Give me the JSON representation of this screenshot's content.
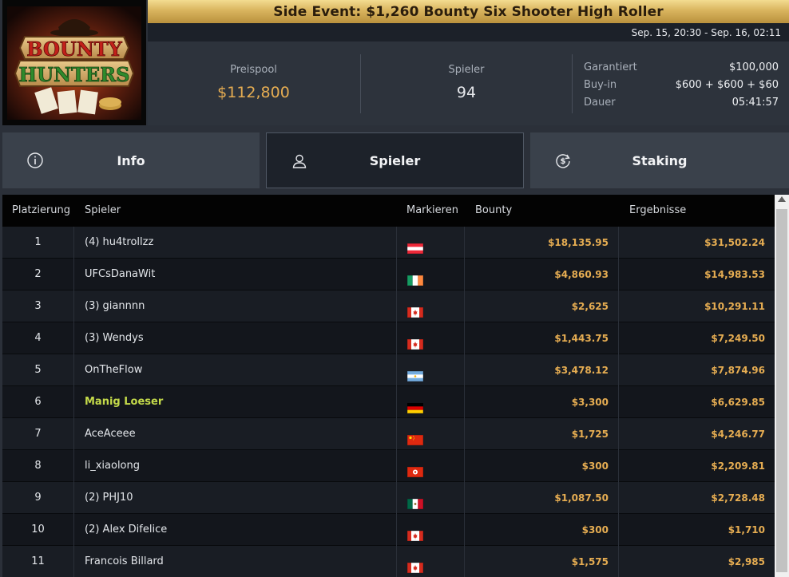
{
  "header": {
    "title": "Side Event: $1,260 Bounty Six Shooter High Roller",
    "dates": "Sep. 15, 20:30 - Sep. 16, 02:11",
    "logo_text": [
      "BOUNTY",
      "HUNTERS"
    ]
  },
  "stats": {
    "prizepool_label": "Preispool",
    "prizepool_value": "$112,800",
    "players_label": "Spieler",
    "players_value": "94",
    "details": [
      {
        "label": "Garantiert",
        "value": "$100,000"
      },
      {
        "label": "Buy-in",
        "value": "$600 + $600 + $60"
      },
      {
        "label": "Dauer",
        "value": "05:41:57"
      }
    ]
  },
  "tabs": [
    {
      "label": "Info",
      "icon": "info-icon"
    },
    {
      "label": "Spieler",
      "icon": "user-icon",
      "active": true
    },
    {
      "label": "Staking",
      "icon": "dollar-cycle-icon"
    }
  ],
  "table": {
    "columns": [
      "Platzierung",
      "Spieler",
      "Markieren",
      "Bounty",
      "Ergebnisse"
    ],
    "rows": [
      {
        "rank": "1",
        "player": "(4) hu4trollzz",
        "flag": "austria",
        "bounty": "$18,135.95",
        "result": "$31,502.24"
      },
      {
        "rank": "2",
        "player": "UFCsDanaWit",
        "flag": "ireland",
        "bounty": "$4,860.93",
        "result": "$14,983.53"
      },
      {
        "rank": "3",
        "player": "(3) giannnn",
        "flag": "canada",
        "bounty": "$2,625",
        "result": "$10,291.11"
      },
      {
        "rank": "4",
        "player": "(3) Wendys",
        "flag": "canada",
        "bounty": "$1,443.75",
        "result": "$7,249.50"
      },
      {
        "rank": "5",
        "player": "OnTheFlow",
        "flag": "argentina",
        "bounty": "$3,478.12",
        "result": "$7,874.96"
      },
      {
        "rank": "6",
        "player": "Manig Loeser",
        "flag": "germany",
        "bounty": "$3,300",
        "result": "$6,629.85",
        "highlight": true
      },
      {
        "rank": "7",
        "player": "AceAceee",
        "flag": "china",
        "bounty": "$1,725",
        "result": "$4,246.77"
      },
      {
        "rank": "8",
        "player": "li_xiaolong",
        "flag": "hongkong",
        "bounty": "$300",
        "result": "$2,209.81"
      },
      {
        "rank": "9",
        "player": "(2) PHJ10",
        "flag": "mexico",
        "bounty": "$1,087.50",
        "result": "$2,728.48"
      },
      {
        "rank": "10",
        "player": "(2) Alex Difelice",
        "flag": "canada",
        "bounty": "$300",
        "result": "$1,710"
      },
      {
        "rank": "11",
        "player": "Francois Billard",
        "flag": "canada",
        "bounty": "$1,575",
        "result": "$2,985"
      }
    ]
  },
  "colors": {
    "accent_gold": "#e6ad52",
    "highlight_player": "#c4da4a"
  }
}
